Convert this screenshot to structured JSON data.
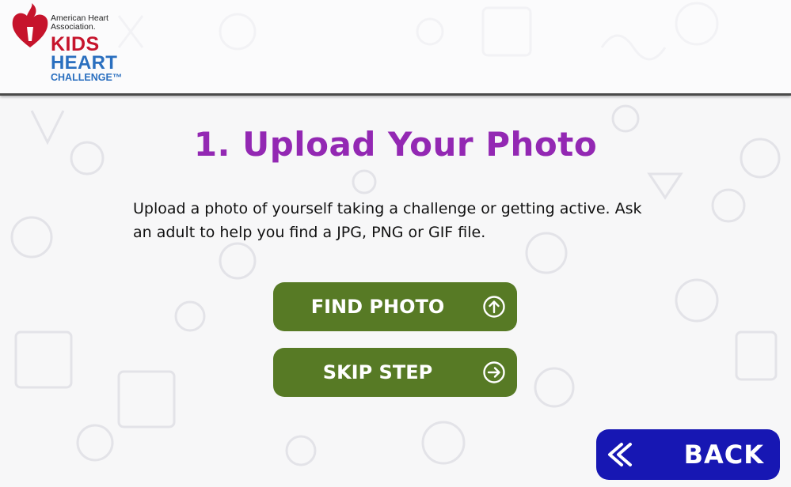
{
  "brand": {
    "org_line1": "American Heart",
    "org_line2": "Association.",
    "kids": "KIDS",
    "heart": "HEART",
    "challenge": "CHALLENGE™",
    "colors": {
      "red": "#c6142c",
      "purple": "#7b1fa2",
      "blue": "#2a6fbf"
    }
  },
  "main": {
    "title": "1. Upload Your Photo",
    "description": "Upload a photo of yourself taking a challenge or getting active. Ask an adult to help you find a JPG, PNG or GIF file."
  },
  "buttons": {
    "find_photo": {
      "label": "FIND PHOTO",
      "icon": "upload-arrow-circle-icon"
    },
    "skip_step": {
      "label": "SKIP STEP",
      "icon": "arrow-right-circle-icon"
    },
    "back": {
      "label": "BACK",
      "icon": "double-chevron-left-icon"
    }
  },
  "colors": {
    "title": "#9328b3",
    "green_button": "#577a25",
    "back_button": "#1717b3"
  }
}
